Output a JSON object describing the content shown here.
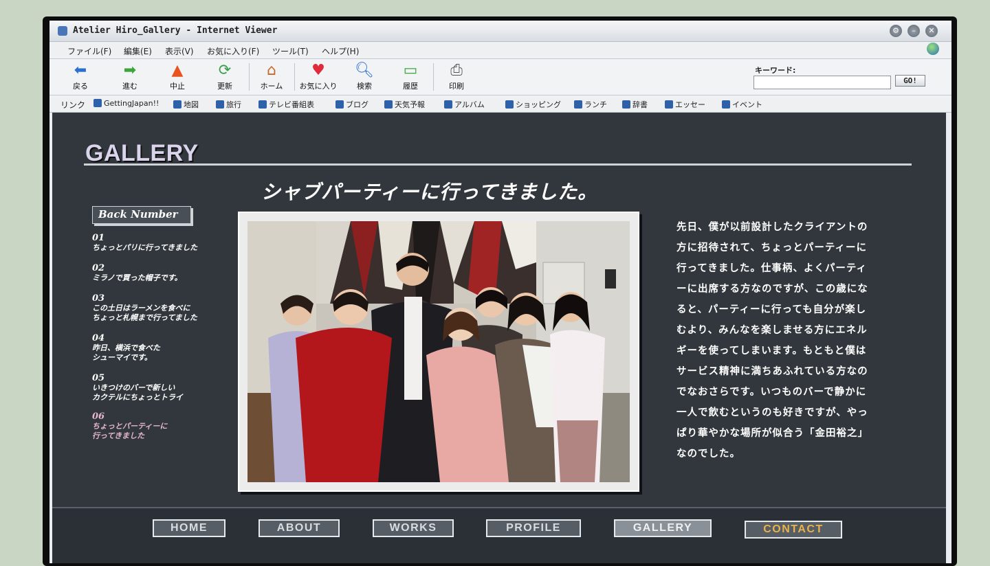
{
  "window": {
    "title": "Atelier Hiro_Gallery - Internet Viewer"
  },
  "menu": [
    "ファイル(F)",
    "編集(E)",
    "表示(V)",
    "お気に入り(F)",
    "ツール(T)",
    "ヘルプ(H)"
  ],
  "toolbar": {
    "buttons": [
      {
        "label": "戻る",
        "icon": "back-arrow-icon"
      },
      {
        "label": "進む",
        "icon": "forward-arrow-icon"
      },
      {
        "label": "中止",
        "icon": "stop-cone-icon"
      },
      {
        "label": "更新",
        "icon": "refresh-icon"
      },
      {
        "label": "ホーム",
        "icon": "home-icon"
      },
      {
        "label": "お気に入り",
        "icon": "heart-icon"
      },
      {
        "label": "検索",
        "icon": "search-icon"
      },
      {
        "label": "履歴",
        "icon": "history-icon"
      },
      {
        "label": "印刷",
        "icon": "printer-icon"
      }
    ],
    "keyword_label": "キーワード:",
    "keyword_value": "",
    "go_label": "GO!"
  },
  "links": {
    "label": "リンク",
    "items": [
      "GettingJapan!!",
      "地図",
      "旅行",
      "テレビ番組表",
      "ブログ",
      "天気予報",
      "アルバム",
      "ショッピング",
      "ランチ",
      "辞書",
      "エッセー",
      "イベント"
    ]
  },
  "page": {
    "title": "GALLERY",
    "headline": "シャブパーティーに行ってきました。",
    "back_number_label": "Back Number",
    "back_numbers": [
      {
        "num": "01",
        "text": "ちょっとパリに行ってきました"
      },
      {
        "num": "02",
        "text": "ミラノで買った帽子です。"
      },
      {
        "num": "03",
        "text": "この土日はラーメンを食べに\nちょっと札幌まで行ってました"
      },
      {
        "num": "04",
        "text": "昨日、横浜で食べた\nシューマイです。"
      },
      {
        "num": "05",
        "text": "いきつけのバーで新しい\nカクテルにちょっとトライ"
      },
      {
        "num": "06",
        "text": "ちょっとパーティーに\n行ってきました"
      }
    ],
    "body": "先日、僕が以前設計したクライアントの\n方に招待されて、ちょっとパーティーに\n行ってきました。仕事柄、よくパーティ\nーに出席する方なのですが、この歳にな\nると、パーティーに行っても自分が楽し\nむより、みんなを楽しませる方にエネル\nギーを使ってしまいます。もともと僕は\nサービス精神に満ちあふれている方なの\nでなおさらです。いつものバーで静かに\n一人で飲むというのも好きですが、やっ\nぱり華やかな場所が似合う「金田裕之」\nなのでした。"
  },
  "nav": [
    "HOME",
    "ABOUT",
    "WORKS",
    "PROFILE",
    "GALLERY",
    "CONTACT"
  ],
  "colors": {
    "content_bg": "#31373c",
    "accent_pink": "#e7b8cc",
    "contact_orange": "#e9b24b"
  }
}
